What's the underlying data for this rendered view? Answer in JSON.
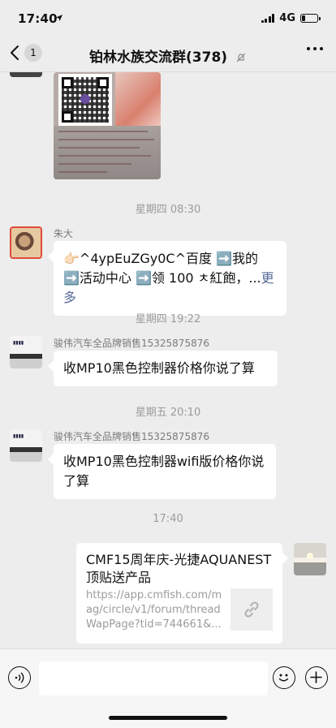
{
  "status": {
    "time": "17:40",
    "network": "4G",
    "battery_level": 0.25
  },
  "nav": {
    "back_count": "1",
    "title": "铂林水族交流群(378)"
  },
  "timestamps": [
    "星期四 08:30",
    "星期四 19:22",
    "星期五 20:10",
    "17:40"
  ],
  "messages": [
    {
      "sender": "朱大",
      "text": "👉🏻^4ypEuZGy0C^百度 ➡️我的 ➡️活动中心 ➡️领 100 ㅊ紅飽，...",
      "more": "更多"
    },
    {
      "sender": "骏伟汽车全品牌销售15325875876",
      "text": "收MP10黑色控制器价格你说了算"
    },
    {
      "sender": "骏伟汽车全品牌销售15325875876",
      "text": "收MP10黑色控制器wifi版价格你说了算"
    }
  ],
  "link_card": {
    "title": "CMF15周年庆-光捷AQUANEST顶贴送产品",
    "url": "https://app.cmfish.com/mag/circle/v1/forum/threadWapPage?tid=744661&..."
  },
  "colors": {
    "background": "#ededed",
    "bubble": "#ffffff",
    "link": "#576b95",
    "muted": "#9b9b9b"
  }
}
